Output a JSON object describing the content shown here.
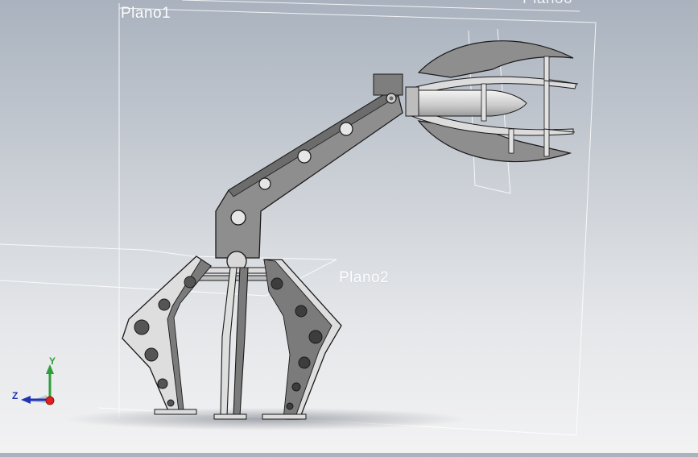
{
  "viewport": {
    "planes": {
      "plano1": "Plano1",
      "plano2": "Plano2",
      "plano3": "Planoo"
    }
  },
  "triad": {
    "y": "Y",
    "z": "Z"
  },
  "colors": {
    "part_fill": "#8e8e8e",
    "part_dark": "#5a5a5a",
    "part_light": "#dedede",
    "edge": "#1a1a1a",
    "plane_line": "#ffffff",
    "axis_x": "#e02020",
    "axis_y": "#2f9e3a",
    "axis_z": "#2333b5"
  }
}
